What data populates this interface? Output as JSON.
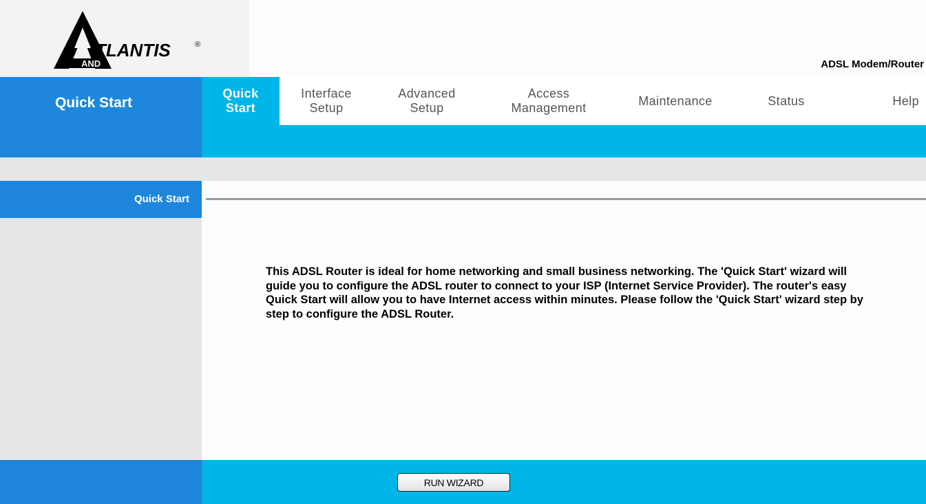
{
  "header": {
    "logo_text": "TLANTIS",
    "logo_sub": "AND",
    "logo_registered": "®",
    "product_name": "ADSL Modem/Router"
  },
  "sidebar": {
    "title": "Quick Start",
    "section_label": "Quick Start"
  },
  "nav": {
    "tabs": [
      {
        "label": "Quick Start",
        "active": true
      },
      {
        "label": "Interface Setup",
        "active": false
      },
      {
        "label": "Advanced Setup",
        "active": false
      },
      {
        "label": "Access Management",
        "active": false
      },
      {
        "label": "Maintenance",
        "active": false
      },
      {
        "label": "Status",
        "active": false
      },
      {
        "label": "Help",
        "active": false
      }
    ]
  },
  "main": {
    "description": "This ADSL Router is ideal for home networking and small business networking. The 'Quick Start' wizard will guide you to configure the ADSL router to connect to your ISP (Internet Service Provider). The router's easy Quick Start will allow you to have Internet access within minutes. Please follow the 'Quick Start' wizard step by step to configure the ADSL Router."
  },
  "footer": {
    "run_wizard_label": "RUN WIZARD"
  },
  "colors": {
    "primary_blue": "#1e87db",
    "accent_cyan": "#00b5e8",
    "light_gray": "#e6e6e6"
  }
}
